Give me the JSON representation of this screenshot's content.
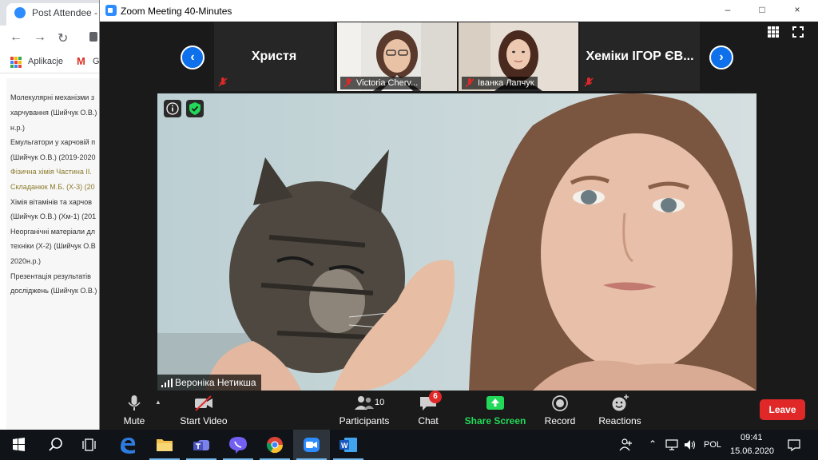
{
  "browser": {
    "tab_title": "Post Attendee - Z",
    "bookmarks": {
      "apps_label": "Aplikacje",
      "gmail_label": "G"
    },
    "courses": [
      "Молекулярні механізми з",
      "харчування (Шийчук О.В.)",
      "н.р.)",
      "Емульгатори у харчовій п",
      "(Шийчук О.В.) (2019-2020",
      "Фізична хімія Частина II.",
      "Складанюк М.Б. (Х-3) (20",
      "Хімія вітамінів та харчов",
      "(Шийчук О.В.) (Хм-1) (201",
      "Неорганічні матеріали дл",
      "техніки (Х-2) (Шийчук О.В",
      "2020н.р.)",
      "Презентація результатів",
      "досліджень (Шийчук О.В.)"
    ]
  },
  "zoom": {
    "window_title": "Zoom Meeting 40-Minutes",
    "window_controls": {
      "minimize": "–",
      "maximize": "□",
      "close": "×"
    },
    "thumbnails": [
      {
        "name": "Христя",
        "type": "name-only",
        "muted": true
      },
      {
        "name": "Victoria Cherv...",
        "type": "video",
        "muted": true
      },
      {
        "name": "Іванка Лапчук",
        "type": "video",
        "muted": true
      },
      {
        "name": "Хеміки ІГОР ЄВ...",
        "type": "name-only",
        "muted": true
      }
    ],
    "nav_prev": "‹",
    "nav_next": "›",
    "active_speaker": "Вероніка Нетикша",
    "toolbar": {
      "mute": "Mute",
      "start_video": "Start Video",
      "participants": "Participants",
      "participants_count": "10",
      "chat": "Chat",
      "chat_badge": "6",
      "share_screen": "Share Screen",
      "record": "Record",
      "reactions": "Reactions",
      "leave": "Leave"
    },
    "colors": {
      "accent_blue": "#0e71eb",
      "share_green": "#23d959",
      "leave_red": "#e02828"
    }
  },
  "taskbar": {
    "apps": [
      "start-icon",
      "search-icon",
      "task-view-icon",
      "edge-icon",
      "file-explorer-icon",
      "teams-icon",
      "viber-icon",
      "chrome-icon",
      "zoom-icon",
      "word-icon"
    ],
    "language": "POL",
    "time": "09:41",
    "date": "15.06.2020"
  }
}
